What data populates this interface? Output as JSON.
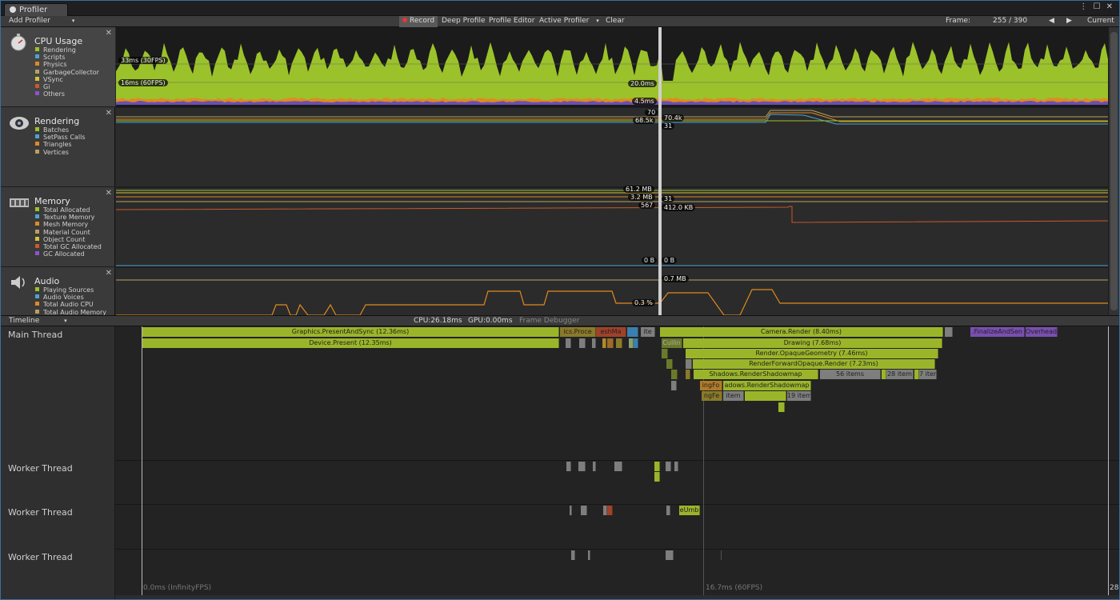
{
  "window": {
    "tab_title": "Profiler",
    "controls": "⋮ ☐ ✕"
  },
  "toolbar": {
    "add_profiler": "Add Profiler",
    "record": "Record",
    "deep_profile": "Deep Profile",
    "profile_editor": "Profile Editor",
    "active_profiler": "Active Profiler",
    "clear": "Clear",
    "frame_label": "Frame:",
    "frame_value": "255 / 390",
    "prev": "◀",
    "next": "▶",
    "current": "Current"
  },
  "modules": {
    "cpu": {
      "title": "CPU Usage",
      "legend": [
        {
          "name": "Rendering",
          "color": "#9bc22a"
        },
        {
          "name": "Scripts",
          "color": "#4aa3d6"
        },
        {
          "name": "Physics",
          "color": "#e08a20"
        },
        {
          "name": "GarbageCollector",
          "color": "#b8a060"
        },
        {
          "name": "VSync",
          "color": "#d6c23a"
        },
        {
          "name": "Gi",
          "color": "#c85a2a"
        },
        {
          "name": "Others",
          "color": "#8855cc"
        }
      ]
    },
    "rendering": {
      "title": "Rendering",
      "legend": [
        {
          "name": "Batches",
          "color": "#9bc22a"
        },
        {
          "name": "SetPass Calls",
          "color": "#4aa3d6"
        },
        {
          "name": "Triangles",
          "color": "#e08a20"
        },
        {
          "name": "Vertices",
          "color": "#b8a060"
        }
      ]
    },
    "memory": {
      "title": "Memory",
      "legend": [
        {
          "name": "Total Allocated",
          "color": "#9bc22a"
        },
        {
          "name": "Texture Memory",
          "color": "#4aa3d6"
        },
        {
          "name": "Mesh Memory",
          "color": "#e08a20"
        },
        {
          "name": "Material Count",
          "color": "#b8a060"
        },
        {
          "name": "Object Count",
          "color": "#d6c23a"
        },
        {
          "name": "Total GC Allocated",
          "color": "#c85a2a"
        },
        {
          "name": "GC Allocated",
          "color": "#8855cc"
        }
      ]
    },
    "audio": {
      "title": "Audio",
      "legend": [
        {
          "name": "Playing Sources",
          "color": "#9bc22a"
        },
        {
          "name": "Audio Voices",
          "color": "#4aa3d6"
        },
        {
          "name": "Total Audio CPU",
          "color": "#e08a20"
        },
        {
          "name": "Total Audio Memory",
          "color": "#b8a060"
        }
      ]
    }
  },
  "graph_labels": {
    "cpu_30fps": "33ms (30FPS)",
    "cpu_60fps": "16ms (60FPS)",
    "cpu_sel_total": "20.0ms",
    "cpu_sel_other": "4.5ms",
    "rend_a": "70",
    "rend_b": "68.5k",
    "rend_c": "70.4k",
    "rend_d": "31",
    "mem_a": "61.2 MB",
    "mem_b": "3.2 MB",
    "mem_c": "31",
    "mem_d": "567",
    "mem_e": "412.0 KB",
    "mem_f": "0 B",
    "mem_g": "0 B",
    "aud_a": "0.7 MB",
    "aud_b": "0.3 %"
  },
  "timeline_bar": {
    "mode": "Timeline",
    "cpu": "CPU:26.18ms",
    "gpu": "GPU:0.00ms",
    "frame_debugger": "Frame Debugger"
  },
  "threads": [
    "Main Thread",
    "Worker Thread",
    "Worker Thread",
    "Worker Thread"
  ],
  "blocks": {
    "present_sync": "Graphics.PresentAndSync (12.36ms)",
    "device_present": "Device.Present (12.35ms)",
    "phys_proc": "ics.Proce",
    "mesh": "eshMa",
    "ite": "ite",
    "camera_render": "Camera.Render (8.40ms)",
    "finalize": ".FinalizeAndSen",
    "overhead": "Overhead",
    "culling": "Cullin",
    "drawing": "Drawing (7.68ms)",
    "opaque": "Render.OpaqueGeometry (7.46ms)",
    "fwd_opaque": "RenderForwardOpaque.Render (7.23ms)",
    "shadows": "Shadows.RenderShadowmap",
    "items56": "56 items",
    "items28": "28 item",
    "items7": "7 iter",
    "shadowmap2": "adows.RenderShadowmap",
    "ngfo": "ingFo",
    "ngfe": "ngFe",
    "item": "item",
    "items19": "19 item",
    "eumb": "eUmb"
  },
  "ticks": {
    "t0": "0.0ms (InfinityFPS)",
    "t1": "16.7ms (60FPS)",
    "right": "28"
  }
}
